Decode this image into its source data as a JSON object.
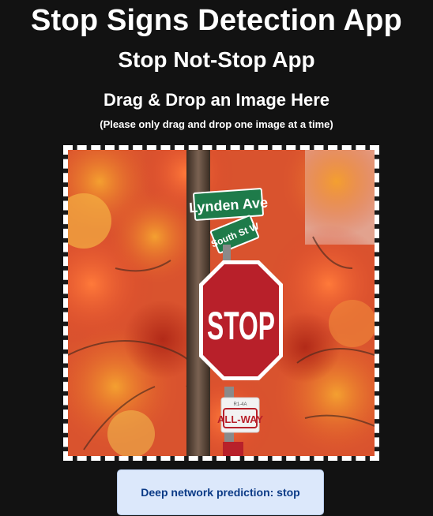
{
  "app": {
    "title": "Stop Signs Detection App",
    "subtitle": "Stop Not-Stop App"
  },
  "dropzone": {
    "heading": "Drag & Drop an Image Here",
    "note": "(Please only drag and drop one image at a time)",
    "image": {
      "street_sign_top": "Lynden Ave",
      "street_sign_bottom": "South St W",
      "sign_text": "STOP",
      "plaque_small_text": "R1-4A",
      "plaque_text": "ALL-WAY"
    }
  },
  "result": {
    "prediction_text": "Deep network prediction: stop"
  },
  "colors": {
    "background": "#121212",
    "prediction_bg": "#dce8fb",
    "prediction_text": "#0b3a86",
    "stop_red": "#b8202a"
  }
}
